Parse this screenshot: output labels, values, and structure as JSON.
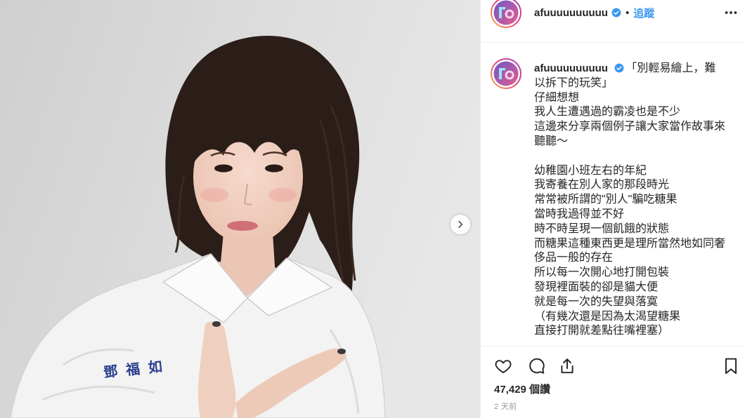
{
  "photo": {
    "shirt_embroidery": "鄧福如",
    "next_button_icon": "chevron-right-icon"
  },
  "header": {
    "avatar_icon": "profile-avatar",
    "username": "afuuuuuuuuuu",
    "verified_icon": "verified-badge-icon",
    "separator": "•",
    "follow_label": "追蹤",
    "more_icon": "more-options-icon"
  },
  "caption": {
    "username": "afuuuuuuuuuu",
    "verified_icon": "verified-badge-icon",
    "title_start": "「別輕易繪上，難",
    "paragraphs": [
      [
        "以拆下的玩笑」",
        "仔細想想",
        "我人生遭遇過的霸凌也是不少",
        "這邊來分享兩個例子讓大家當作故事來",
        "聽聽～"
      ],
      [
        "幼稚園小班左右的年紀",
        "我寄養在別人家的那段時光",
        "常常被所謂的\"別人\"騙吃糖果",
        "當時我過得並不好",
        "時不時呈現一個飢餓的狀態",
        "而糖果這種東西更是理所當然地如同奢",
        "侈品一般的存在",
        "所以每一次開心地打開包裝",
        "發現裡面裝的卻是貓大便",
        "就是每一次的失望與落寞",
        "（有幾次還是因為太渴望糖果",
        "直接打開就差點往嘴裡塞）"
      ]
    ]
  },
  "actions": {
    "like_icon": "heart-icon",
    "comment_icon": "comment-icon",
    "share_icon": "share-icon",
    "save_icon": "bookmark-icon"
  },
  "likes": "47,429 個讚",
  "posted": "2 天前",
  "colors": {
    "text": "#262626",
    "link": "#3897f0",
    "muted": "#999999",
    "border": "#efefef",
    "verified": "#3897f0",
    "embroidery": "#2b3f8c"
  }
}
